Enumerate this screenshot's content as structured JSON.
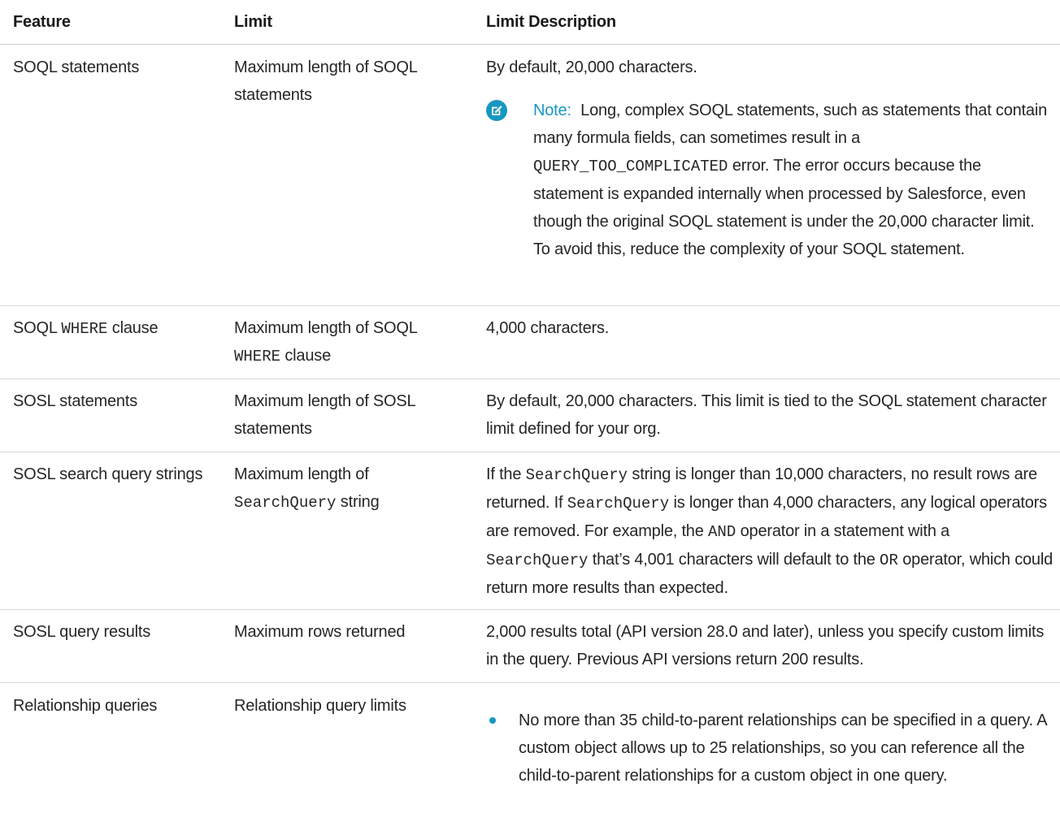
{
  "headers": {
    "feature": "Feature",
    "limit": "Limit",
    "description": "Limit Description"
  },
  "rows": [
    {
      "feature": "SOQL statements",
      "limit": "Maximum length of SOQL statements",
      "description": "By default, 20,000 characters.",
      "note": {
        "icon": "edit-note-icon",
        "label": "Note:",
        "text_1": "Long, complex SOQL statements, such as statements that contain many formula fields, can sometimes result in a",
        "code_1": "QUERY_TOO_COMPLICATED",
        "text_2": "error. The error occurs because the statement is expanded internally when processed by Salesforce, even though the original SOQL statement is under the 20,000 character limit. To avoid this, reduce the complexity of your SOQL statement."
      }
    },
    {
      "feature_prefix": "SOQL",
      "feature_code": "WHERE",
      "feature_suffix": "clause",
      "limit_text": "Maximum length of SOQL",
      "limit_code": "WHERE",
      "limit_suffix": "clause",
      "description": "4,000 characters."
    },
    {
      "feature": "SOSL statements",
      "limit": "Maximum length of SOSL statements",
      "description": "By default, 20,000 characters. This limit is tied to the SOQL statement character limit defined for your org."
    },
    {
      "feature": "SOSL search query strings",
      "limit_text": "Maximum length of",
      "limit_code": "SearchQuery",
      "limit_suffix": "string",
      "desc": {
        "t1": "If the",
        "c1": "SearchQuery",
        "t2": "string is longer than 10,000 characters, no result rows are returned. If",
        "c2": "SearchQuery",
        "t3": "is longer than 4,000 characters, any logical operators are removed. For example, the",
        "c3": "AND",
        "t4": "operator in a statement with a",
        "c4": "SearchQuery",
        "t5": "that’s 4,001 characters will default to the",
        "c5": "OR",
        "t6": "operator, which could return more results than expected."
      }
    },
    {
      "feature": "SOSL query results",
      "limit": "Maximum rows returned",
      "description": "2,000 results total (API version 28.0 and later), unless you specify custom limits in the query. Previous API versions return 200 results."
    },
    {
      "feature": "Relationship queries",
      "limit": "Relationship query limits",
      "bullets": [
        "No more than 35 child-to-parent relationships can be specified in a query. A custom object allows up to 25 relationships, so you can reference all the child-to-parent relationships for a custom object in one query."
      ]
    }
  ],
  "colors": {
    "accent": "#1798c1",
    "text": "#262626",
    "divider": "#d8d8d8"
  }
}
